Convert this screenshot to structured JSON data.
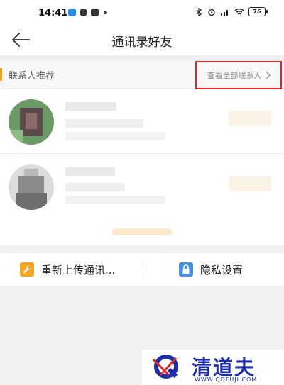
{
  "status_bar": {
    "time": "14:41",
    "battery": "76"
  },
  "header": {
    "title": "通讯录好友"
  },
  "section": {
    "title": "联系人推荐",
    "view_all": "查看全部联系人"
  },
  "actions": {
    "upload_label": "重新上传通讯...",
    "privacy_label": "隐私设置"
  },
  "watermark": {
    "text": "清道夫",
    "url": "WWW.QDFUJI.COM"
  },
  "colors": {
    "accent": "#f4a623",
    "highlight_border": "#e0282a",
    "privacy_icon": "#4a90e2",
    "brand": "#1f2fa8"
  },
  "icons": {
    "back": "arrow-left-icon",
    "chevron": "chevron-right-icon",
    "wrench": "wrench-icon",
    "lock": "lock-icon"
  }
}
